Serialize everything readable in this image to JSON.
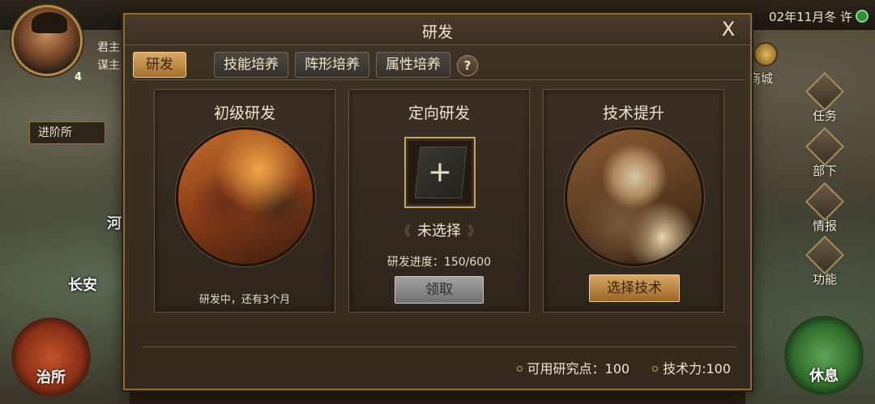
{
  "hud": {
    "date": "02年11月冬 许",
    "avatar_level": "4",
    "side_labels": [
      "君主",
      "谋主"
    ],
    "advance_label": "进阶所",
    "map_labels": [
      "河",
      "长安"
    ],
    "shop_label": "商城",
    "right_menu": [
      "任务",
      "部下",
      "情报",
      "功能"
    ],
    "left_round": "治所",
    "right_round": "休息"
  },
  "dialog": {
    "title": "研发",
    "close": "X",
    "tabs": [
      {
        "label": "研发",
        "active": true
      },
      {
        "label": "技能培养",
        "active": false
      },
      {
        "label": "阵形培养",
        "active": false
      },
      {
        "label": "属性培养",
        "active": false
      }
    ],
    "help": "?",
    "panels": {
      "basic": {
        "title": "初级研发",
        "status": "研发中，还有3个月"
      },
      "directed": {
        "title": "定向研发",
        "slot_plus": "+",
        "arrow_left": "《",
        "arrow_right": "》",
        "selected": "未选择",
        "progress": "研发进度：150/600",
        "claim_button": "领取"
      },
      "tech": {
        "title": "技术提升",
        "choose_button": "选择技术"
      }
    },
    "footer": {
      "research_points": "可用研究点：100",
      "tech_power": "技术力:100"
    }
  }
}
